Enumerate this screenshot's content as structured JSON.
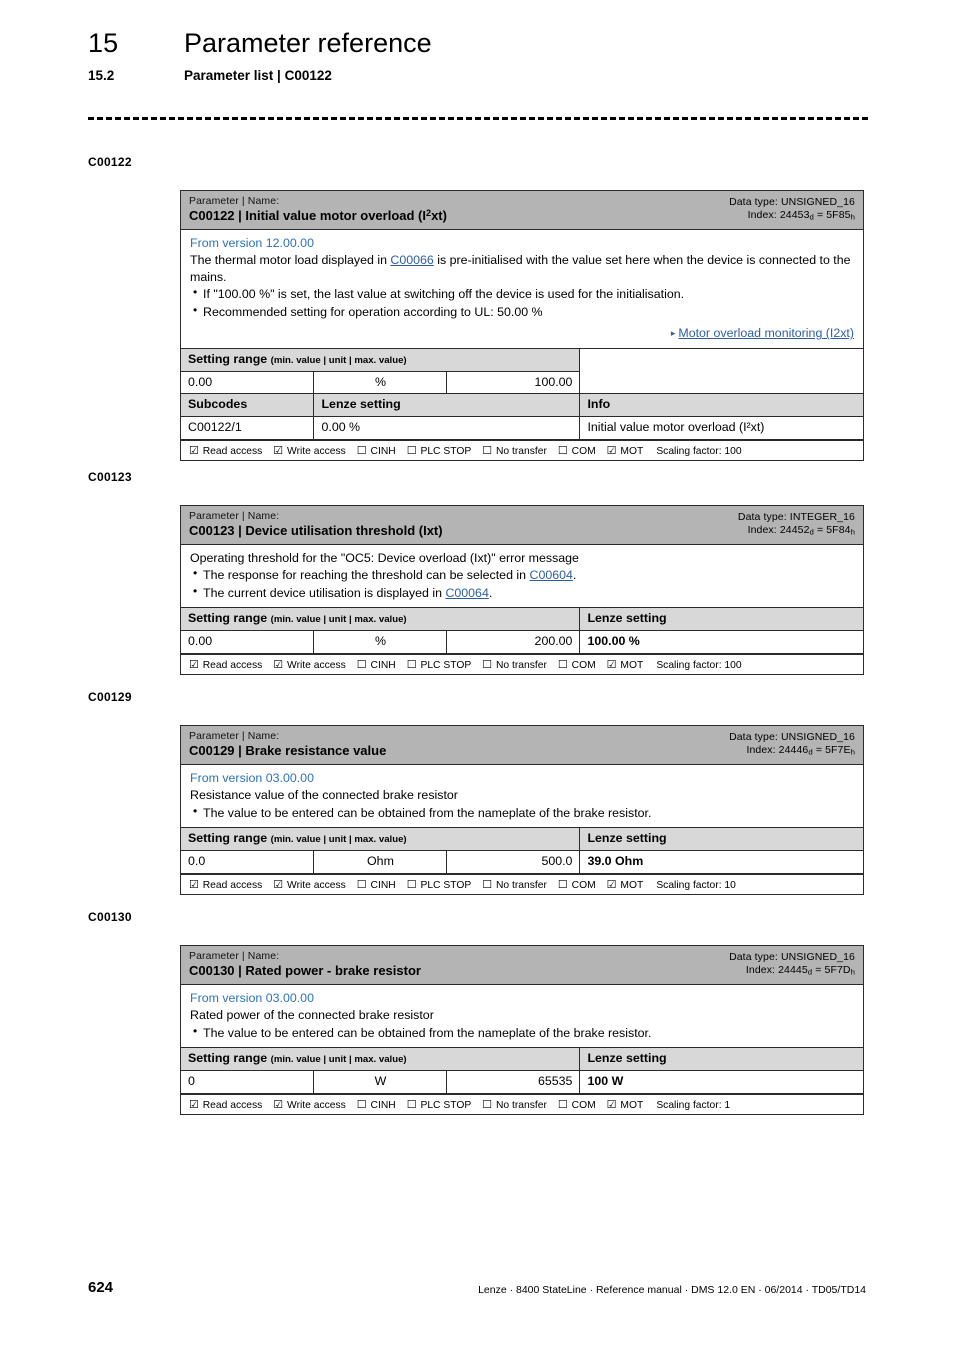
{
  "header": {
    "chapter_number": "15",
    "chapter_title": "Parameter reference",
    "section_number": "15.2",
    "section_title": "Parameter list | C00122"
  },
  "footer": {
    "page_number": "624",
    "text": "Lenze · 8400 StateLine · Reference manual · DMS 12.0 EN · 06/2014 · TD05/TD14"
  },
  "labels": {
    "kicker": "Parameter | Name:",
    "data_type_prefix": "Data type: ",
    "index_prefix": "Index: ",
    "setting_range": "Setting range",
    "setting_range_sub": "(min. value | unit | max. value)",
    "lenze_setting": "Lenze setting",
    "subcodes": "Subcodes",
    "info": "Info",
    "checked": "☑",
    "unchecked": "☐",
    "triangle": "▸"
  },
  "flag_names": {
    "read": "Read access",
    "write": "Write access",
    "cinh": "CINH",
    "plcstop": "PLC STOP",
    "notransfer": "No transfer",
    "com": "COM",
    "mot": "MOT"
  },
  "blocks": [
    {
      "margin_label": "C00122",
      "code": "C00122",
      "name": "C00122 | Initial value motor overload (I²xt)",
      "data_type": "UNSIGNED_16",
      "index_dec": "24453",
      "index_hex": "5F85",
      "version": "From version 12.00.00",
      "desc_pre": "The thermal motor load displayed in ",
      "desc_link": "C00066",
      "desc_post": " is pre-initialised with the value set here when the device is connected to the mains.",
      "bullets": [
        "If \"100.00 %\" is set, the last value at switching off the device is used for the initialisation.",
        "Recommended setting for operation according to UL: 50.00 %"
      ],
      "xref": "Motor overload monitoring (I2xt)",
      "min": "0.00",
      "unit": "%",
      "max": "100.00",
      "subcode_row": {
        "subcode": "C00122/1",
        "lenze_setting": "0.00 %",
        "info": "Initial value motor overload (I²xt)"
      },
      "flags": {
        "read": "☑",
        "write": "☑",
        "cinh": "☐",
        "plcstop": "☐",
        "notransfer": "☐",
        "com": "☐",
        "mot": "☑"
      },
      "scaling": "Scaling factor: 100"
    },
    {
      "margin_label": "C00123",
      "code": "C00123",
      "name": "C00123 | Device utilisation threshold (Ixt)",
      "data_type": "INTEGER_16",
      "index_dec": "24452",
      "index_hex": "5F84",
      "version": "",
      "desc_pre": "Operating threshold for the \"OC5: Device overload (Ixt)\" error message",
      "bullets_rich": [
        {
          "pre": "The response for reaching the threshold can be selected in ",
          "link": "C00604",
          "post": "."
        },
        {
          "pre": "The current device utilisation is displayed in ",
          "link": "C00064",
          "post": "."
        }
      ],
      "min": "0.00",
      "unit": "%",
      "max": "200.00",
      "lenze_setting": "100.00 %",
      "flags": {
        "read": "☑",
        "write": "☑",
        "cinh": "☐",
        "plcstop": "☐",
        "notransfer": "☐",
        "com": "☐",
        "mot": "☑"
      },
      "scaling": "Scaling factor: 100"
    },
    {
      "margin_label": "C00129",
      "code": "C00129",
      "name": "C00129 | Brake resistance value",
      "data_type": "UNSIGNED_16",
      "index_dec": "24446",
      "index_hex": "5F7E",
      "version": "From version 03.00.00",
      "desc_pre": "Resistance value of the connected brake resistor",
      "bullets": [
        "The value to be entered can be obtained from the nameplate of the brake resistor."
      ],
      "min": "0.0",
      "unit": "Ohm",
      "max": "500.0",
      "lenze_setting": "39.0 Ohm",
      "flags": {
        "read": "☑",
        "write": "☑",
        "cinh": "☐",
        "plcstop": "☐",
        "notransfer": "☐",
        "com": "☐",
        "mot": "☑"
      },
      "scaling": "Scaling factor: 10"
    },
    {
      "margin_label": "C00130",
      "code": "C00130",
      "name": "C00130 | Rated power - brake resistor",
      "data_type": "UNSIGNED_16",
      "index_dec": "24445",
      "index_hex": "5F7D",
      "version": "From version 03.00.00",
      "desc_pre": "Rated power of the connected brake resistor",
      "bullets": [
        "The value to be entered can be obtained from the nameplate of the brake resistor."
      ],
      "min": "0",
      "unit": "W",
      "max": "65535",
      "lenze_setting": "100 W",
      "flags": {
        "read": "☑",
        "write": "☑",
        "cinh": "☐",
        "plcstop": "☐",
        "notransfer": "☐",
        "com": "☐",
        "mot": "☑"
      },
      "scaling": "Scaling factor: 1"
    }
  ]
}
